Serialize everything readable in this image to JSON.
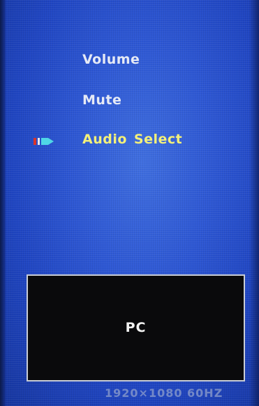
{
  "menu": {
    "items": [
      {
        "label": "Volume",
        "selected": false
      },
      {
        "label": "Mute",
        "selected": false
      },
      {
        "label_part1": "Audio",
        "label_part2": "Select",
        "selected": true
      }
    ],
    "selector_icon": "arrow-right-icon"
  },
  "source": {
    "label": "PC"
  },
  "status": {
    "resolution": "1920×1080 60HZ"
  },
  "colors": {
    "background": "#2d57d4",
    "item_text": "#e6eaf5",
    "selected_text": "#f3f07a",
    "source_box_bg": "#0a0a0c",
    "icon_red": "#d8342a",
    "icon_cyan": "#4fd6e6"
  }
}
